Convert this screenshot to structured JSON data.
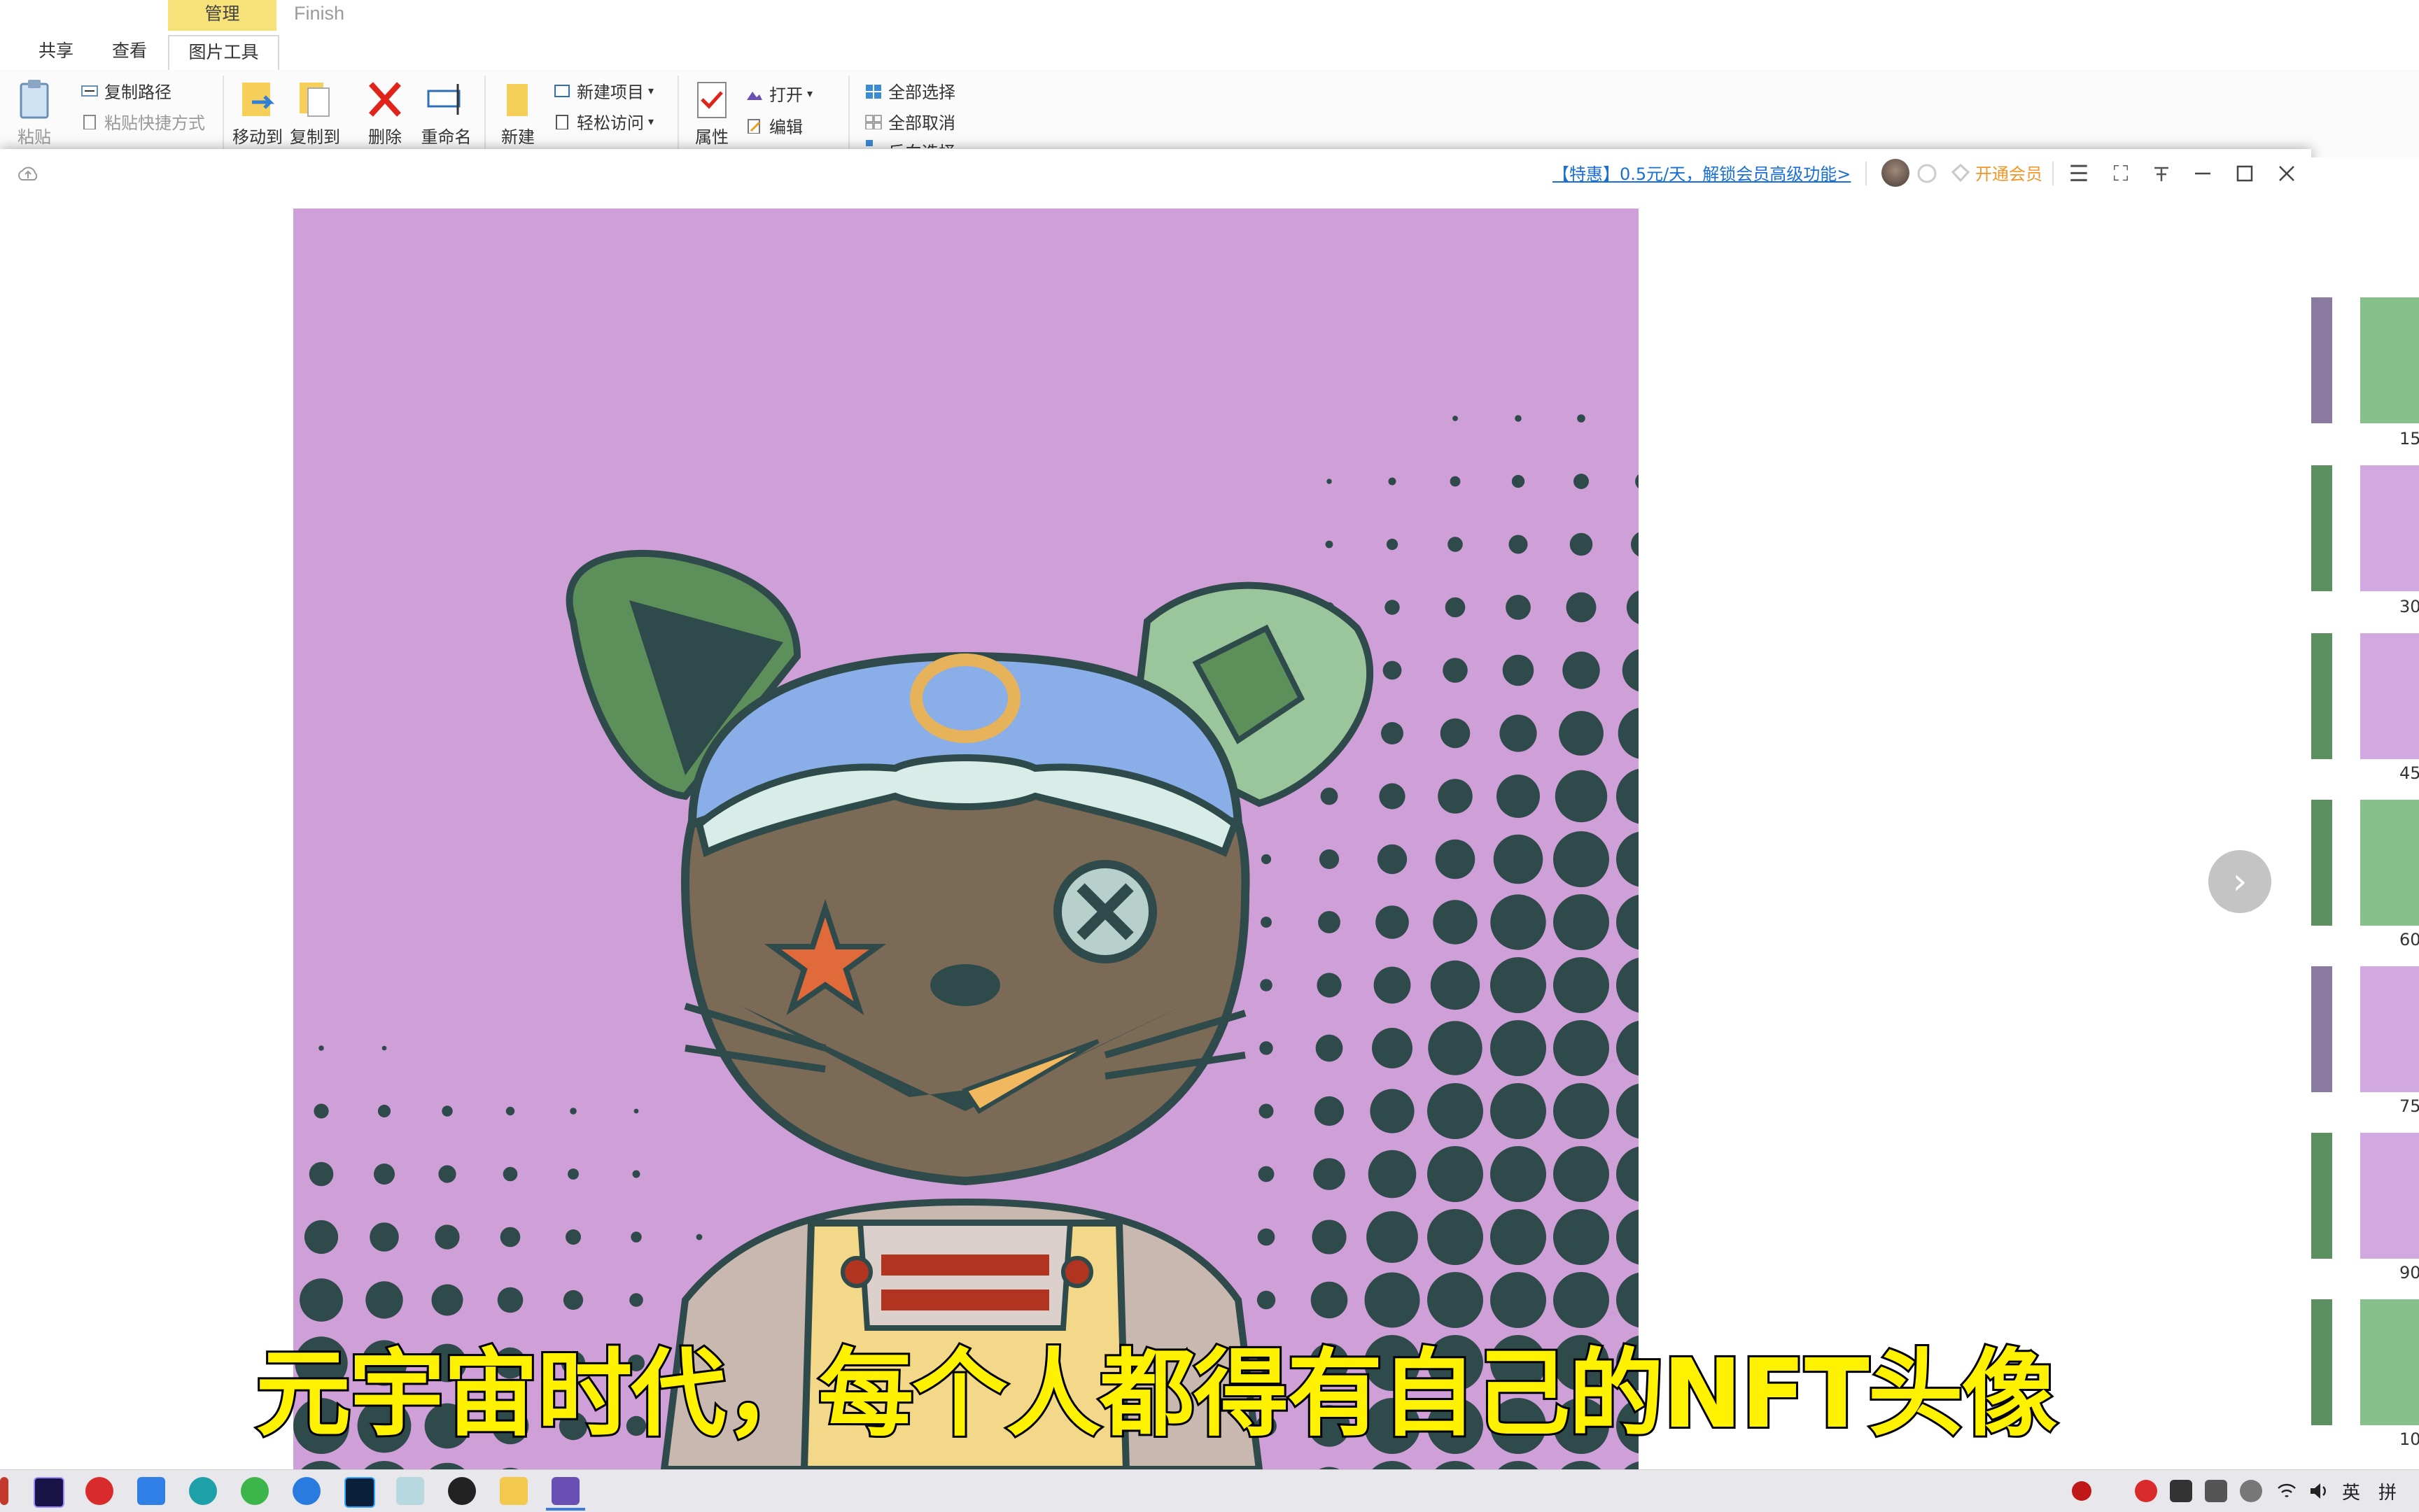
{
  "ribbon": {
    "context_header": "管理",
    "finish_label": "Finish",
    "tabs": [
      "共享",
      "查看",
      "图片工具"
    ],
    "buttons": {
      "paste": "粘贴",
      "copy_path": "复制路径",
      "paste_shortcut": "粘贴快捷方式",
      "move_to": "移动到",
      "copy_to": "复制到",
      "delete": "删除",
      "rename": "重命名",
      "new_folder": "新建",
      "new_item": "新建项目",
      "easy_access": "轻松访问",
      "properties": "属性",
      "open": "打开",
      "edit": "编辑",
      "select_all": "全部选择",
      "select_none": "全部取消",
      "invert_selection": "反向选择"
    }
  },
  "viewer": {
    "promo_link": "【特惠】0.5元/天，解锁会员高级功能>",
    "vip_button": "开通会员"
  },
  "thumbnails": {
    "numbers": [
      "15",
      "30",
      "45",
      "60",
      "75",
      "90",
      "10"
    ]
  },
  "subtitle": "元宇宙时代，每个人都得有自己的NFT头像",
  "taskbar": {
    "tray_lang": "英",
    "tray_ime": "拼"
  },
  "colors": {
    "image_background": "#cf9fd8",
    "subtitle_fill": "#fff200",
    "promo_link": "#1a6fd6",
    "vip_orange": "#f0962b"
  }
}
